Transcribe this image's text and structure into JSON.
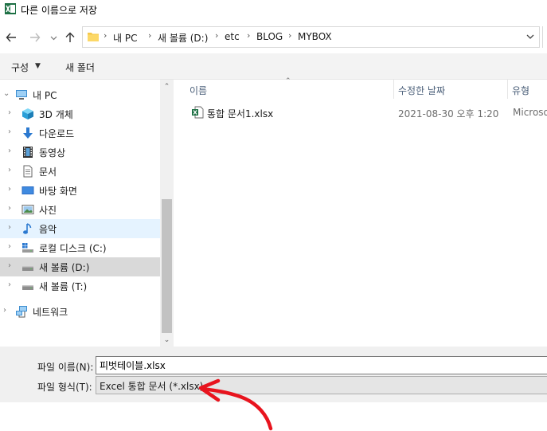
{
  "window": {
    "title": "다른 이름으로 저장",
    "app_icon": "excel-icon"
  },
  "nav": {
    "back_icon": "arrow-left-icon",
    "forward_icon": "arrow-right-icon",
    "recent_icon": "chevron-down-icon",
    "up_icon": "arrow-up-icon"
  },
  "address": {
    "crumbs": [
      "내 PC",
      "새 볼륨 (D:)",
      "etc",
      "BLOG",
      "MYBOX"
    ]
  },
  "commands": {
    "organize": "구성",
    "new_folder": "새 폴더"
  },
  "navpane": {
    "items": [
      {
        "label": "내 PC",
        "icon": "pc-icon",
        "expanded": true
      },
      {
        "label": "3D 개체",
        "icon": "cube-icon"
      },
      {
        "label": "다운로드",
        "icon": "download-icon"
      },
      {
        "label": "동영상",
        "icon": "video-icon"
      },
      {
        "label": "문서",
        "icon": "document-icon"
      },
      {
        "label": "바탕 화면",
        "icon": "desktop-icon"
      },
      {
        "label": "사진",
        "icon": "picture-icon"
      },
      {
        "label": "음악",
        "icon": "music-icon",
        "state": "hover"
      },
      {
        "label": "로컬 디스크 (C:)",
        "icon": "drive-c-icon"
      },
      {
        "label": "새 볼륨 (D:)",
        "icon": "drive-icon",
        "state": "selected"
      },
      {
        "label": "새 볼륨 (T:)",
        "icon": "drive-icon"
      },
      {
        "label": "네트워크",
        "icon": "network-icon"
      }
    ]
  },
  "filelist": {
    "columns": [
      "이름",
      "수정한 날짜",
      "유형"
    ],
    "rows": [
      {
        "name": "통합 문서1.xlsx",
        "modified": "2021-08-30 오후 1:20",
        "type": "Microso",
        "icon": "excel-file-icon"
      }
    ]
  },
  "save": {
    "filename_label": "파일 이름(N):",
    "filename_value": "피벗테이블.xlsx",
    "filetype_label": "파일 형식(T):",
    "filetype_value": "Excel 통합 문서 (*.xlsx)"
  },
  "annotation": {
    "color": "#e8141e"
  }
}
